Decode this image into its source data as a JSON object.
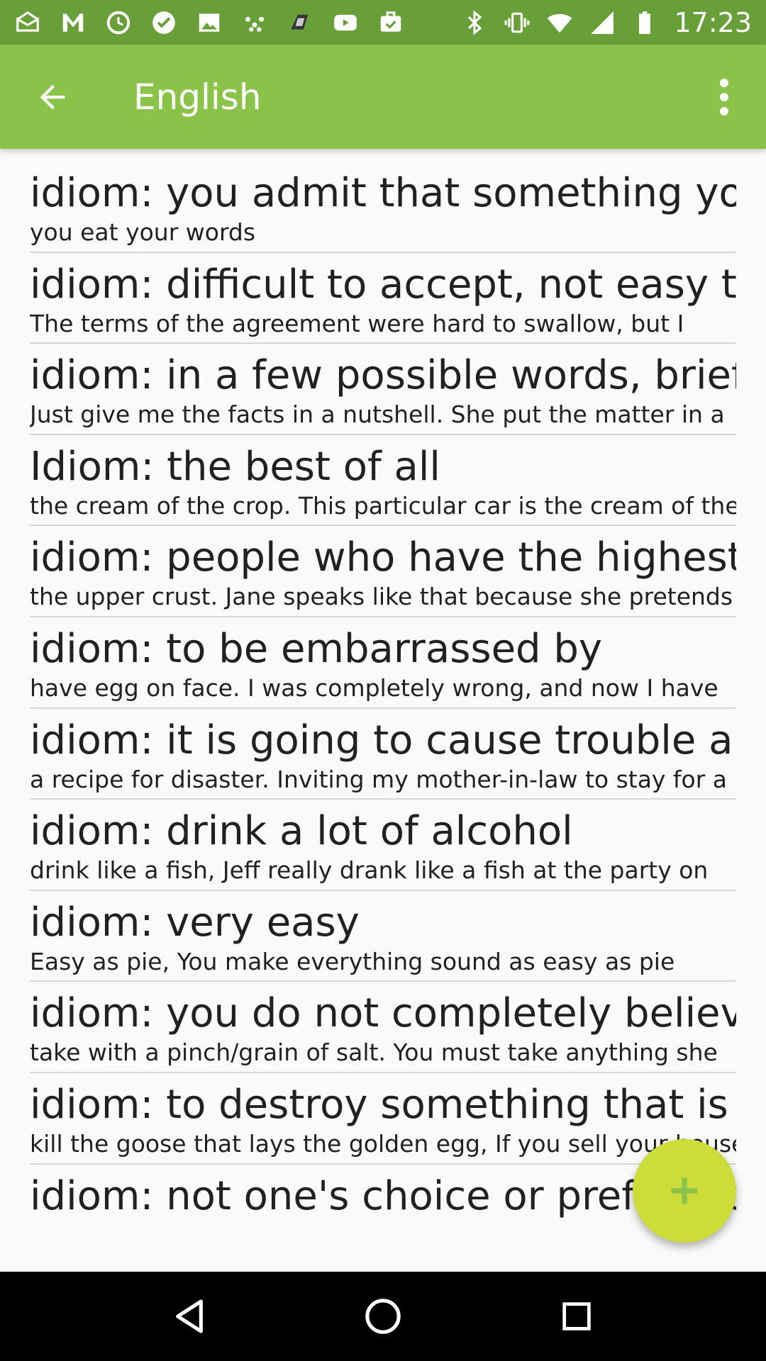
{
  "status_bar": {
    "time": "17:23",
    "left_icons": [
      "mail-icon",
      "gmail-icon",
      "clock-icon",
      "check-heart-icon",
      "image-icon",
      "dots-icon",
      "app-icon",
      "youtube-icon",
      "briefcase-check-icon"
    ],
    "right_icons": [
      "bluetooth-icon",
      "vibrate-icon",
      "wifi-icon",
      "signal-icon",
      "battery-icon"
    ]
  },
  "app_bar": {
    "title": "English",
    "back_icon": "arrow-back-icon",
    "menu_icon": "more-vert-icon"
  },
  "colors": {
    "status_bar": "#689f38",
    "app_bar": "#8bc34a",
    "fab": "#cddc39",
    "fab_icon": "#8bc34a"
  },
  "items": [
    {
      "title": "idiom: you admit that something you",
      "subtitle": "you eat your words"
    },
    {
      "title": "idiom: difficult to accept, not easy to",
      "subtitle": "The terms of the agreement were hard to swallow, but I"
    },
    {
      "title": "idiom: in a few possible words, briefly,",
      "subtitle": "Just give me the facts in a nutshell. She put the matter in a"
    },
    {
      "title": "Idiom: the best of all",
      "subtitle": "the cream of the crop. This particular car is the cream of the"
    },
    {
      "title": "idiom: people who have the highest",
      "subtitle": "the upper crust. Jane speaks like that because she pretends"
    },
    {
      "title": "idiom: to be embarrassed by",
      "subtitle": "have egg on face. I was completely wrong, and now I have"
    },
    {
      "title": "idiom: it is going to cause trouble and",
      "subtitle": "a recipe for disaster. Inviting my mother-in-law to stay for a"
    },
    {
      "title": "idiom: drink a lot of alcohol",
      "subtitle": "drink like a fish, Jeff really drank like a fish at the party on"
    },
    {
      "title": "idiom: very easy",
      "subtitle": "Easy as pie, You make everything sound as easy as pie"
    },
    {
      "title": "idiom: you do not completely believe it,",
      "subtitle": "take with a pinch/grain of salt. You must take anything she"
    },
    {
      "title": "idiom: to destroy something that is",
      "subtitle": "kill the goose that lays the golden egg, If you sell your house"
    },
    {
      "title": "idiom: not one's choice or preference",
      "subtitle": ""
    }
  ],
  "fab": {
    "icon": "plus-icon"
  },
  "nav_bar": {
    "icons": [
      "back-triangle-icon",
      "home-circle-icon",
      "recents-square-icon"
    ]
  }
}
